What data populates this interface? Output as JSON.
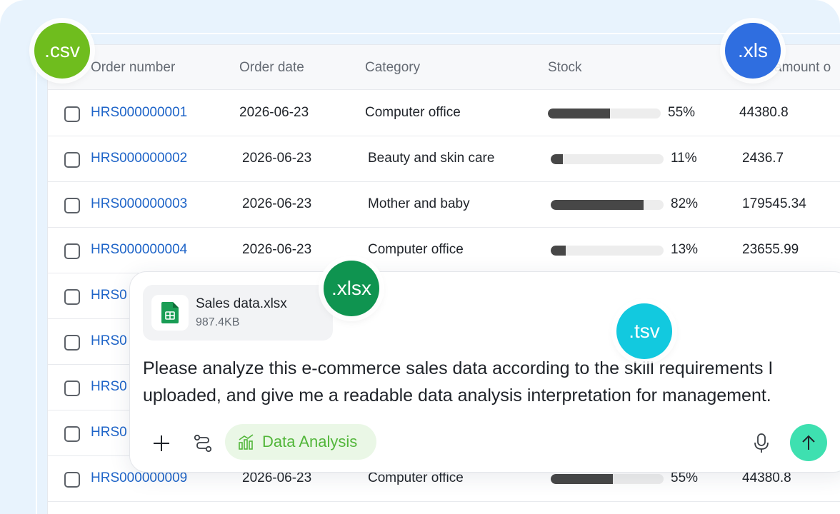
{
  "table": {
    "columns": [
      "Order number",
      "Order date",
      "Category",
      "Stock",
      "amount o"
    ],
    "rows": [
      {
        "order": "HRS000000001",
        "date": "2026-06-23",
        "category": "Computer office",
        "stock": 0.55,
        "stock_label": "55%",
        "amount": "44380.8"
      },
      {
        "order": "HRS000000002",
        "date": "2026-06-23",
        "category": "Beauty and skin care",
        "stock": 0.11,
        "stock_label": "11%",
        "amount": "2436.7"
      },
      {
        "order": "HRS000000003",
        "date": "2026-06-23",
        "category": "Mother and baby",
        "stock": 0.82,
        "stock_label": "82%",
        "amount": "179545.34"
      },
      {
        "order": "HRS000000004",
        "date": "2026-06-23",
        "category": "Computer office",
        "stock": 0.13,
        "stock_label": "13%",
        "amount": "23655.99"
      },
      {
        "order": "HRS0"
      },
      {
        "order": "HRS0"
      },
      {
        "order": "HRS0"
      },
      {
        "order": "HRS0"
      },
      {
        "order": "HRS000000009",
        "date": "2026-06-23",
        "category": "Computer office",
        "stock": 0.55,
        "stock_label": "55%",
        "amount": "44380.8"
      }
    ]
  },
  "badges": {
    "csv": {
      "label": ".csv",
      "color": "#6fbd1e"
    },
    "xls": {
      "label": ".xls",
      "color": "#2f6ee0"
    },
    "xlsx": {
      "label": ".xlsx",
      "color": "#0f9450"
    },
    "tsv": {
      "label": ".tsv",
      "color": "#12c9df"
    }
  },
  "chat": {
    "attachment": {
      "name": "Sales data.xlsx",
      "size": "987.4KB",
      "icon": "spreadsheet-icon"
    },
    "message": "Please analyze this e-commerce sales data according to the skill requirements I uploaded, and give me a readable data analysis interpretation for management.",
    "skill_label": "Data Analysis",
    "icons": {
      "add": "plus-icon",
      "workflow": "route-icon",
      "skill": "bar-chart-icon",
      "voice": "microphone-icon",
      "send": "arrow-up-icon"
    }
  },
  "colors": {
    "link": "#1e64c8",
    "accent": "#3ee0b0",
    "skill": "#52b63a",
    "bar_fill": "#474747",
    "bar_track": "#ededed"
  }
}
